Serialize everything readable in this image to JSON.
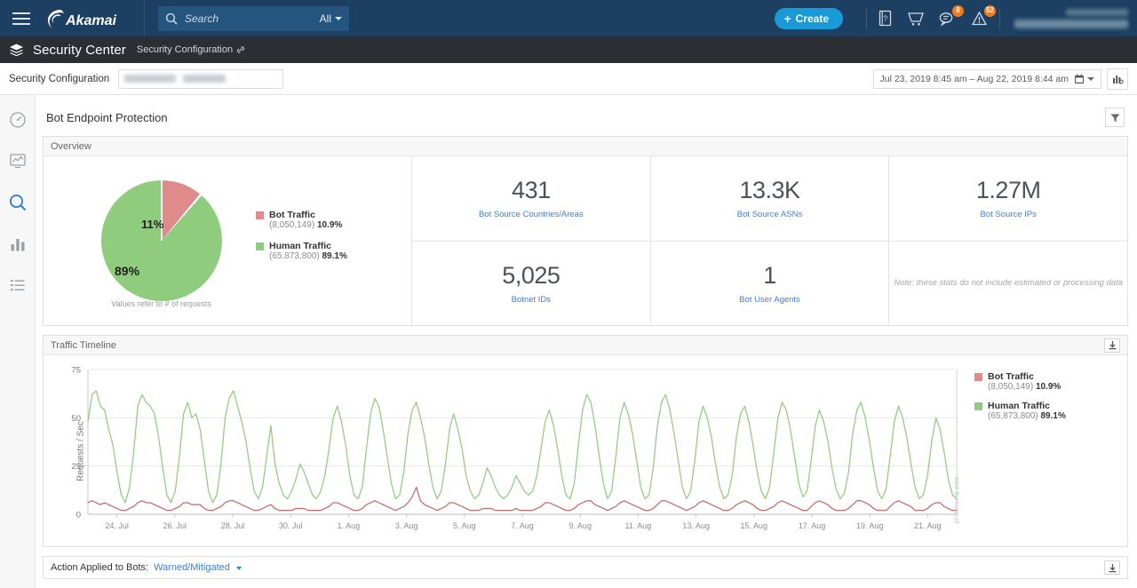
{
  "topbar": {
    "brand": "Akamai",
    "menu_icon": "hamburger-icon",
    "search_placeholder": "Search",
    "search_scope": "All",
    "create_label": "Create",
    "help_badge": "",
    "chat_badge": "8",
    "alert_badge": "52"
  },
  "appbar": {
    "title": "Security Center",
    "breadcrumb": "Security Configuration"
  },
  "configbar": {
    "label": "Security Configuration",
    "date_range": "Jul 23, 2019  8:45 am  –  Aug 22, 2019  8:44 am"
  },
  "sidebar": {
    "items": [
      {
        "name": "dashboard-icon",
        "label": "Dashboard"
      },
      {
        "name": "monitor-icon",
        "label": "Monitor"
      },
      {
        "name": "search-icon",
        "label": "Search"
      },
      {
        "name": "reports-icon",
        "label": "Reports"
      },
      {
        "name": "list-icon",
        "label": "List"
      }
    ]
  },
  "page": {
    "title": "Bot Endpoint Protection",
    "filter_tooltip": "Filter"
  },
  "overview": {
    "panel_title": "Overview",
    "pie_note": "Values refer to # of requests",
    "pie_labels": {
      "bot": "11%",
      "human": "89%"
    },
    "legend": [
      {
        "name": "Bot Traffic",
        "count": "(8,050,149)",
        "pct": "10.9%",
        "color": "#e08b8b"
      },
      {
        "name": "Human Traffic",
        "count": "(65,873,800)",
        "pct": "89.1%",
        "color": "#90cc7e"
      }
    ],
    "stats": [
      {
        "value": "431",
        "label": "Bot Source Countries/Areas"
      },
      {
        "value": "13.3K",
        "label": "Bot Source ASNs"
      },
      {
        "value": "1.27M",
        "label": "Bot Source IPs"
      },
      {
        "value": "5,025",
        "label": "Botnet IDs"
      },
      {
        "value": "1",
        "label": "Bot User Agents"
      }
    ],
    "stats_note": "Note: these stats do not include estimated or processing data"
  },
  "timeline": {
    "panel_title": "Traffic Timeline",
    "download_icon": "download-icon",
    "watermark": "processing data",
    "legend": [
      {
        "name": "Bot Traffic",
        "count": "(8,050,149)",
        "pct": "10.9%",
        "color": "#e08b8b"
      },
      {
        "name": "Human Traffic",
        "count": "(65,873,800)",
        "pct": "89.1%",
        "color": "#90cc7e"
      }
    ]
  },
  "bottom": {
    "label": "Action Applied to Bots:",
    "value": "Warned/Mitigated",
    "download_icon": "download-icon"
  },
  "chart_data": {
    "type": "line",
    "title": "Traffic Timeline",
    "xlabel": "",
    "ylabel": "Requests / Sec",
    "ylim": [
      0,
      75
    ],
    "yticks": [
      0,
      25,
      50,
      75
    ],
    "xticks": [
      "24. Jul",
      "26. Jul",
      "28. Jul",
      "30. Jul",
      "1. Aug",
      "3. Aug",
      "5. Aug",
      "7. Aug",
      "9. Aug",
      "11. Aug",
      "13. Aug",
      "15. Aug",
      "17. Aug",
      "19. Aug",
      "21. Aug"
    ],
    "grid": true,
    "legend_position": "right",
    "series": [
      {
        "name": "Human Traffic",
        "color": "#90cc7e",
        "values": [
          48,
          62,
          64,
          56,
          54,
          44,
          36,
          22,
          10,
          6,
          14,
          32,
          56,
          62,
          58,
          56,
          52,
          40,
          24,
          10,
          6,
          12,
          30,
          52,
          58,
          50,
          52,
          44,
          28,
          12,
          6,
          10,
          26,
          50,
          60,
          64,
          56,
          48,
          38,
          24,
          12,
          8,
          14,
          30,
          46,
          26,
          16,
          10,
          8,
          12,
          18,
          26,
          22,
          16,
          10,
          8,
          12,
          20,
          34,
          50,
          56,
          48,
          36,
          20,
          10,
          8,
          14,
          34,
          52,
          60,
          56,
          44,
          30,
          16,
          8,
          10,
          22,
          42,
          54,
          58,
          50,
          40,
          26,
          14,
          8,
          12,
          26,
          44,
          52,
          44,
          34,
          20,
          12,
          8,
          10,
          16,
          24,
          20,
          14,
          10,
          8,
          10,
          14,
          20,
          16,
          12,
          10,
          12,
          20,
          34,
          48,
          54,
          46,
          34,
          20,
          10,
          8,
          16,
          36,
          54,
          62,
          58,
          46,
          30,
          16,
          8,
          12,
          30,
          50,
          58,
          52,
          42,
          28,
          14,
          8,
          10,
          24,
          46,
          58,
          62,
          54,
          42,
          28,
          14,
          8,
          12,
          28,
          48,
          56,
          50,
          40,
          26,
          14,
          8,
          10,
          20,
          40,
          52,
          56,
          48,
          36,
          22,
          12,
          8,
          14,
          32,
          50,
          58,
          54,
          44,
          30,
          16,
          9,
          12,
          28,
          46,
          54,
          48,
          38,
          24,
          13,
          8,
          11,
          22,
          42,
          54,
          58,
          50,
          38,
          24,
          12,
          8,
          13,
          30,
          48,
          56,
          50,
          40,
          26,
          14,
          8,
          10,
          20,
          38,
          50,
          44,
          32,
          18,
          10,
          8
        ]
      },
      {
        "name": "Bot Traffic",
        "color": "#c36a6a",
        "values": [
          6,
          7,
          6,
          5,
          6,
          5,
          4,
          3,
          2,
          2,
          3,
          4,
          6,
          7,
          6,
          6,
          5,
          4,
          3,
          2,
          2,
          3,
          4,
          6,
          6,
          5,
          5,
          5,
          3,
          2,
          2,
          3,
          4,
          6,
          7,
          7,
          6,
          5,
          4,
          3,
          2,
          2,
          3,
          4,
          5,
          3,
          2,
          2,
          2,
          2,
          3,
          3,
          3,
          2,
          2,
          2,
          2,
          3,
          4,
          6,
          6,
          5,
          4,
          3,
          2,
          2,
          3,
          5,
          6,
          7,
          6,
          5,
          4,
          3,
          2,
          3,
          4,
          6,
          9,
          14,
          7,
          5,
          4,
          3,
          2,
          3,
          4,
          6,
          6,
          5,
          4,
          3,
          2,
          2,
          2,
          3,
          3,
          3,
          2,
          2,
          2,
          2,
          2,
          3,
          2,
          2,
          2,
          2,
          3,
          4,
          6,
          6,
          5,
          4,
          3,
          2,
          2,
          3,
          5,
          6,
          7,
          7,
          5,
          4,
          3,
          2,
          3,
          4,
          6,
          7,
          6,
          5,
          4,
          3,
          2,
          2,
          3,
          5,
          7,
          7,
          6,
          5,
          4,
          3,
          2,
          3,
          4,
          6,
          7,
          6,
          5,
          4,
          3,
          2,
          2,
          3,
          5,
          6,
          7,
          6,
          5,
          3,
          2,
          2,
          3,
          4,
          6,
          7,
          6,
          5,
          4,
          3,
          2,
          2,
          4,
          6,
          7,
          6,
          5,
          3,
          2,
          2,
          2,
          3,
          5,
          7,
          7,
          6,
          5,
          3,
          2,
          2,
          2,
          4,
          6,
          7,
          6,
          5,
          4,
          2,
          2,
          2,
          3,
          5,
          6,
          6,
          4,
          3,
          2,
          2
        ]
      }
    ]
  }
}
